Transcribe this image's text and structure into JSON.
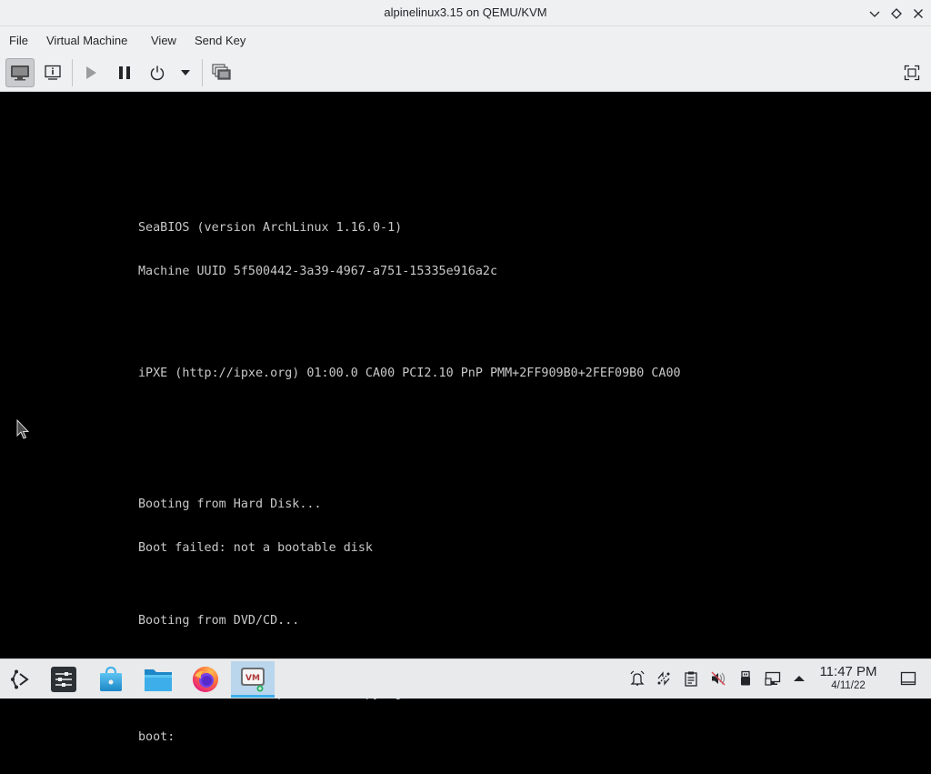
{
  "window": {
    "title": "alpinelinux3.15 on QEMU/KVM",
    "controls": [
      "minimize",
      "maximize",
      "close"
    ]
  },
  "menubar": {
    "items": [
      {
        "label": "File"
      },
      {
        "label": "Virtual Machine"
      },
      {
        "label": "View"
      },
      {
        "label": "Send Key"
      }
    ]
  },
  "toolbar": {
    "buttons": [
      {
        "icon": "console-monitor-icon",
        "state": "active"
      },
      {
        "icon": "details-info-icon"
      },
      {
        "icon": "run-play-icon",
        "state": "disabled"
      },
      {
        "icon": "pause-icon"
      },
      {
        "icon": "power-icon"
      },
      {
        "icon": "dropdown-arrow-icon"
      },
      {
        "icon": "snapshots-icon"
      },
      {
        "icon": "fullscreen-icon"
      }
    ]
  },
  "console": {
    "lines": [
      "SeaBIOS (version ArchLinux 1.16.0-1)",
      "Machine UUID 5f500442-3a39-4967-a751-15335e916a2c",
      "",
      "",
      "iPXE (http://ipxe.org) 01:00.0 CA00 PCI2.10 PnP PMM+2FF909B0+2FEF09B0 CA00",
      "",
      "",
      "",
      "Booting from Hard Disk...",
      "Boot failed: not a bootable disk",
      "",
      "Booting from DVD/CD...",
      "",
      "ISOLINUX 6.04 6.04-pre1 ETCD Copyright (C) 1994-2015 H. Peter Anvin et al",
      "boot:"
    ]
  },
  "taskbar": {
    "apps": [
      {
        "icon": "app-launcher-icon"
      },
      {
        "icon": "system-settings-icon"
      },
      {
        "icon": "discover-store-icon"
      },
      {
        "icon": "file-manager-icon"
      },
      {
        "icon": "firefox-icon"
      },
      {
        "icon": "virt-manager-icon",
        "state": "active"
      }
    ],
    "tray": [
      {
        "icon": "notifications-icon"
      },
      {
        "icon": "kde-connect-icon"
      },
      {
        "icon": "clipboard-icon"
      },
      {
        "icon": "audio-muted-icon"
      },
      {
        "icon": "usb-device-icon"
      },
      {
        "icon": "network-icon"
      },
      {
        "icon": "tray-expand-icon"
      }
    ],
    "clock": {
      "time": "11:47 PM",
      "date": "4/11/22"
    },
    "show_desktop_icon": "show-desktop-icon"
  }
}
